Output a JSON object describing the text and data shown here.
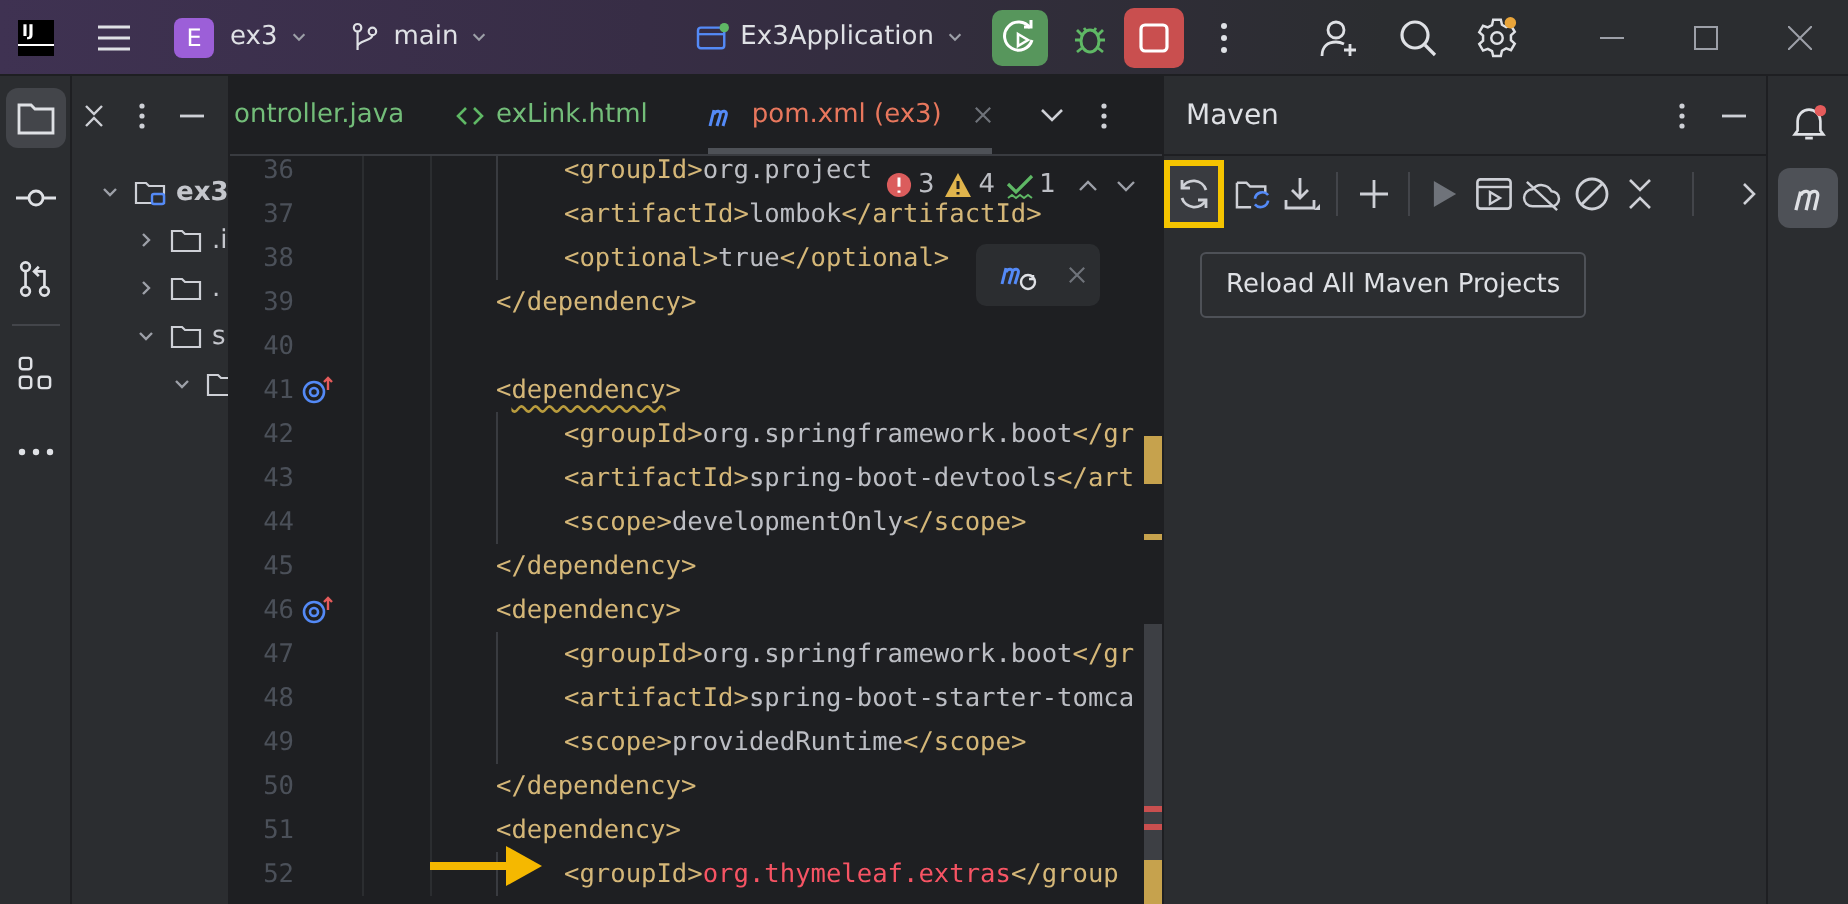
{
  "title_bar": {
    "logo": "IJ",
    "project_badge": "E",
    "project": "ex3",
    "branch": "main",
    "run_config": "Ex3Application"
  },
  "left_toolbar": [
    {
      "kind": "project",
      "selected": true
    },
    {
      "kind": "commit",
      "selected": false
    },
    {
      "kind": "pull-requests",
      "selected": false
    },
    {
      "kind": "structure",
      "selected": false
    },
    {
      "kind": "more",
      "selected": false
    }
  ],
  "project_tree": {
    "items": [
      {
        "label": "ex3",
        "expanded": true,
        "children": [
          {
            "label": ".i",
            "expanded": false
          },
          {
            "label": ".",
            "expanded": false
          },
          {
            "label": "s",
            "expanded": true,
            "children": [
              {
                "expanded": true
              }
            ]
          }
        ]
      }
    ]
  },
  "editor_tabs": [
    {
      "label": "ontroller.java",
      "kind": "java",
      "selected": false
    },
    {
      "label": "exLink.html",
      "kind": "html",
      "selected": false
    },
    {
      "label": "pom.xml (ex3)",
      "kind": "maven",
      "selected": true
    }
  ],
  "inspections": {
    "errors": "3",
    "warnings": "4",
    "typos": "1"
  },
  "code_lines": [
    {
      "number": "36",
      "kind": "inner",
      "marker": false,
      "parts": [
        {
          "kind": "tag",
          "text": "<groupId>"
        },
        {
          "kind": "text",
          "text": "org.project"
        }
      ]
    },
    {
      "number": "37",
      "kind": "inner",
      "marker": false,
      "parts": [
        {
          "kind": "tag",
          "text": "<artifactId>"
        },
        {
          "kind": "text",
          "text": "lombok"
        },
        {
          "kind": "tag",
          "text": "</artifactId>"
        }
      ]
    },
    {
      "number": "38",
      "kind": "inner",
      "marker": false,
      "parts": [
        {
          "kind": "tag",
          "text": "<optional>"
        },
        {
          "kind": "text",
          "text": "true"
        },
        {
          "kind": "tag",
          "text": "</optional>"
        }
      ]
    },
    {
      "number": "39",
      "kind": "outer",
      "marker": false,
      "parts": [
        {
          "kind": "tag",
          "text": "</dependency>"
        }
      ]
    },
    {
      "number": "40",
      "kind": "outer",
      "marker": false
    },
    {
      "number": "41",
      "kind": "outer",
      "marker": true,
      "parts": [
        {
          "kind": "tag",
          "text": "<"
        },
        {
          "kind": "warn-tag",
          "text": "dependency"
        },
        {
          "kind": "tag",
          "text": ">"
        }
      ]
    },
    {
      "number": "42",
      "kind": "inner",
      "marker": false,
      "parts": [
        {
          "kind": "tag",
          "text": "<groupId>"
        },
        {
          "kind": "text",
          "text": "org.springframework.boot"
        },
        {
          "kind": "tag",
          "text": "</gr"
        }
      ]
    },
    {
      "number": "43",
      "kind": "inner",
      "marker": false,
      "parts": [
        {
          "kind": "tag",
          "text": "<artifactId>"
        },
        {
          "kind": "text",
          "text": "spring-boot-devtools"
        },
        {
          "kind": "tag",
          "text": "</art"
        }
      ]
    },
    {
      "number": "44",
      "kind": "inner",
      "marker": false,
      "parts": [
        {
          "kind": "tag",
          "text": "<scope>"
        },
        {
          "kind": "text",
          "text": "developmentOnly"
        },
        {
          "kind": "tag",
          "text": "</scope>"
        }
      ]
    },
    {
      "number": "45",
      "kind": "outer",
      "marker": false,
      "parts": [
        {
          "kind": "tag",
          "text": "</dependency>"
        }
      ]
    },
    {
      "number": "46",
      "kind": "outer",
      "marker": true,
      "parts": [
        {
          "kind": "tag",
          "text": "<dependency>"
        }
      ]
    },
    {
      "number": "47",
      "kind": "inner",
      "marker": false,
      "parts": [
        {
          "kind": "tag",
          "text": "<groupId>"
        },
        {
          "kind": "text",
          "text": "org.springframework.boot"
        },
        {
          "kind": "tag",
          "text": "</gr"
        }
      ]
    },
    {
      "number": "48",
      "kind": "inner",
      "marker": false,
      "parts": [
        {
          "kind": "tag",
          "text": "<artifactId>"
        },
        {
          "kind": "text",
          "text": "spring-boot-starter-tomca"
        }
      ]
    },
    {
      "number": "49",
      "kind": "inner",
      "marker": false,
      "parts": [
        {
          "kind": "tag",
          "text": "<scope>"
        },
        {
          "kind": "text",
          "text": "providedRuntime"
        },
        {
          "kind": "tag",
          "text": "</scope>"
        }
      ]
    },
    {
      "number": "50",
      "kind": "outer",
      "marker": false,
      "parts": [
        {
          "kind": "tag",
          "text": "</dependency>"
        }
      ]
    },
    {
      "number": "51",
      "kind": "outer",
      "marker": false,
      "parts": [
        {
          "kind": "tag",
          "text": "<dependency>"
        }
      ]
    },
    {
      "number": "52",
      "kind": "inner",
      "marker": false,
      "parts": [
        {
          "kind": "tag",
          "text": "<groupId>"
        },
        {
          "kind": "error-text",
          "text": "org.thymeleaf.extras"
        },
        {
          "kind": "tag",
          "text": "</group"
        }
      ]
    }
  ],
  "maven": {
    "title": "Maven",
    "toolbar_groups": [
      [
        {
          "kind": "reload",
          "highlighted": true,
          "disabled": false
        },
        {
          "kind": "sync-folder",
          "highlighted": false,
          "disabled": false
        },
        {
          "kind": "download",
          "highlighted": false,
          "disabled": false
        }
      ],
      [
        {
          "kind": "add",
          "highlighted": false,
          "disabled": false
        }
      ],
      [
        {
          "kind": "run",
          "highlighted": false,
          "disabled": true
        },
        {
          "kind": "execute",
          "highlighted": false,
          "disabled": false
        },
        {
          "kind": "offline",
          "highlighted": false,
          "disabled": false
        },
        {
          "kind": "skip-tests",
          "highlighted": false,
          "disabled": false
        },
        {
          "kind": "collapse",
          "highlighted": false,
          "disabled": false
        }
      ],
      [
        {
          "kind": "more",
          "highlighted": false,
          "disabled": false
        }
      ]
    ],
    "tooltip": "Reload All Maven Projects"
  },
  "right_toolbar": [
    {
      "kind": "notifications",
      "selected": false,
      "badge": true
    },
    {
      "kind": "maven",
      "selected": true,
      "badge": false
    }
  ]
}
